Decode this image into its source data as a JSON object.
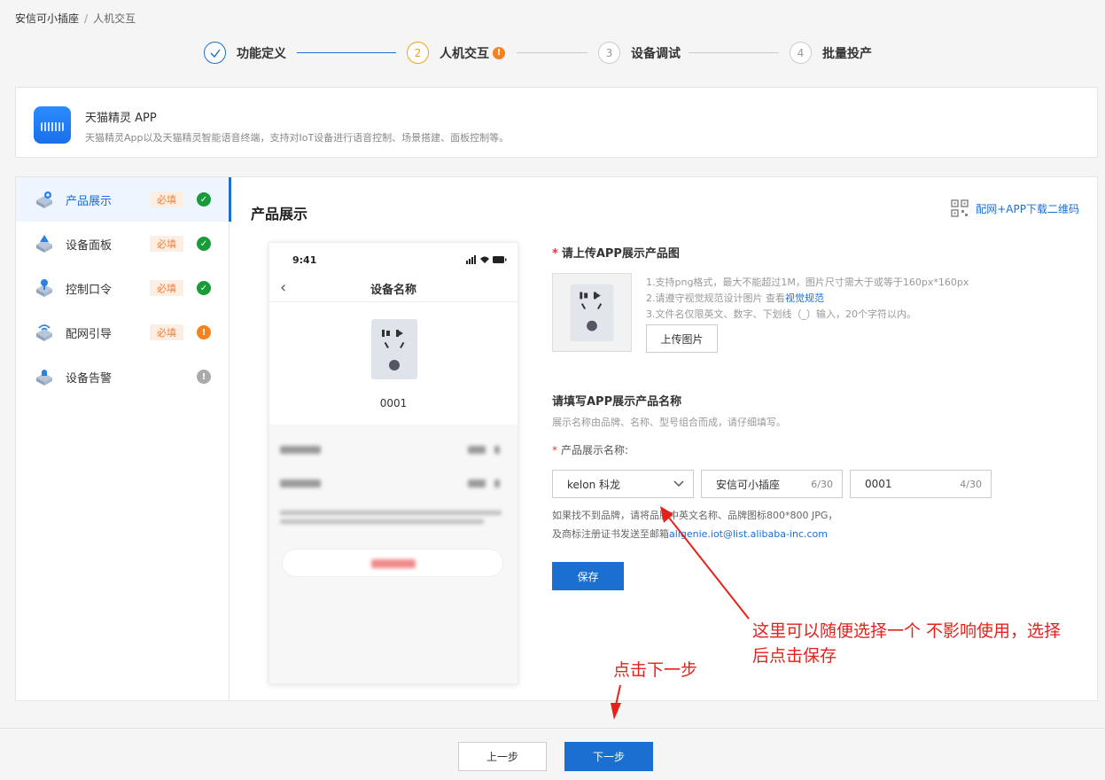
{
  "breadcrumb": {
    "root": "安信可小插座",
    "separator": "/",
    "current": "人机交互"
  },
  "steps": [
    {
      "index": "✓",
      "label": "功能定义"
    },
    {
      "index": "2",
      "label": "人机交互",
      "badge": "!"
    },
    {
      "index": "3",
      "label": "设备调试"
    },
    {
      "index": "4",
      "label": "批量投产"
    }
  ],
  "app": {
    "title": "天猫精灵 APP",
    "description": "天猫精灵App以及天猫精灵智能语音终端，支持对IoT设备进行语音控制、场景搭建、面板控制等。"
  },
  "sidebar": {
    "items": [
      {
        "label": "产品展示",
        "tag": "必填",
        "status": "ok",
        "status_glyph": "✓",
        "icon": "product-display-icon"
      },
      {
        "label": "设备面板",
        "tag": "必填",
        "status": "ok",
        "status_glyph": "✓",
        "icon": "device-panel-icon"
      },
      {
        "label": "控制口令",
        "tag": "必填",
        "status": "ok",
        "status_glyph": "✓",
        "icon": "voice-command-icon"
      },
      {
        "label": "配网引导",
        "tag": "必填",
        "status": "warn",
        "status_glyph": "!",
        "icon": "network-guide-icon"
      },
      {
        "label": "设备告警",
        "tag": "",
        "status": "gray",
        "status_glyph": "!",
        "icon": "device-alarm-icon"
      }
    ]
  },
  "section": {
    "title": "产品展示",
    "qr_link": "配网+APP下载二维码"
  },
  "phone": {
    "time": "9:41",
    "title": "设备名称",
    "number": "0001"
  },
  "form": {
    "upload_label": "请上传APP展示产品图",
    "upload_hint_1": "1.支持png格式，最大不能超过1M，图片尺寸需大于或等于160px*160px",
    "upload_hint_2_prefix": "2.请遵守视觉规范设计图片 查看",
    "upload_hint_2_link": "视觉规范",
    "upload_hint_3": "3.文件名仅限英文、数字、下划线（_）输入，20个字符以内。",
    "upload_button": "上传图片",
    "name_label": "请填写APP展示产品名称",
    "name_hint": "展示名称由品牌、名称、型号组合而成，请仔细填写。",
    "display_name_label": "产品展示名称:",
    "brand_value": "kelon 科龙",
    "name_value": "安信可小插座",
    "name_counter": "6/30",
    "model_value": "0001",
    "model_counter": "4/30",
    "note_1": "如果找不到品牌，请将品牌中英文名称、品牌图标800*800 JPG，",
    "note_2_prefix": "及商标注册证书发送至邮箱",
    "note_2_email": "aligenie.iot@list.alibaba-inc.com",
    "save_button": "保存"
  },
  "annotations": {
    "select_note_line1": "这里可以随便选择一个 不影响使用，选择",
    "select_note_line2": "后点击保存",
    "next_note": "点击下一步"
  },
  "footer": {
    "prev": "上一步",
    "next": "下一步"
  },
  "colors": {
    "primary": "#1a6fd1",
    "warning": "#f58220",
    "success": "#1a9b3a",
    "annotation": "#e4221b"
  }
}
